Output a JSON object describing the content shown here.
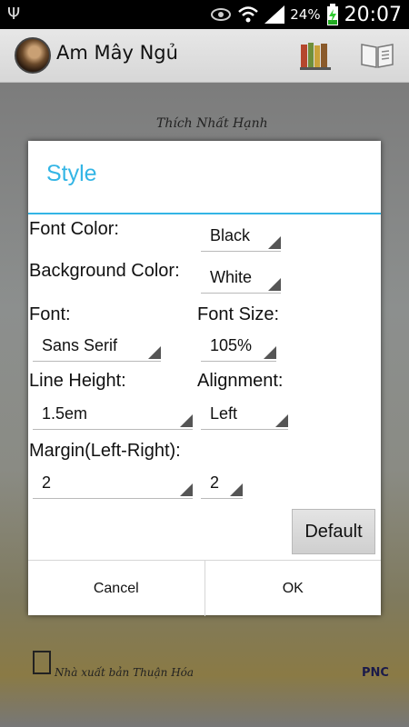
{
  "status_bar": {
    "battery_percent": "24%",
    "time": "20:07",
    "icons": [
      "usb-icon",
      "eye-icon",
      "wifi-icon",
      "signal-icon",
      "battery-charging-icon"
    ]
  },
  "action_bar": {
    "title": "Am Mây Ngủ",
    "icons": [
      "avatar",
      "books-icon",
      "reader-icon"
    ]
  },
  "cover": {
    "author": "Thích Nhất Hạnh",
    "publisher": "Nhà xuất bản Thuận Hóa",
    "logo_text": "PNC"
  },
  "dialog": {
    "title": "Style",
    "accent_color": "#33b5e5",
    "font_color_label": "Font Color:",
    "font_color_value": "Black",
    "background_color_label": "Background Color:",
    "background_color_value": "White",
    "font_label": "Font:",
    "font_value": "Sans Serif",
    "font_size_label": "Font Size:",
    "font_size_value": "105%",
    "line_height_label": "Line Height:",
    "line_height_value": "1.5em",
    "alignment_label": "Alignment:",
    "alignment_value": "Left",
    "margin_label": "Margin(Left-Right):",
    "margin_left_value": "2",
    "margin_right_value": "2",
    "default_button": "Default",
    "cancel_button": "Cancel",
    "ok_button": "OK"
  }
}
